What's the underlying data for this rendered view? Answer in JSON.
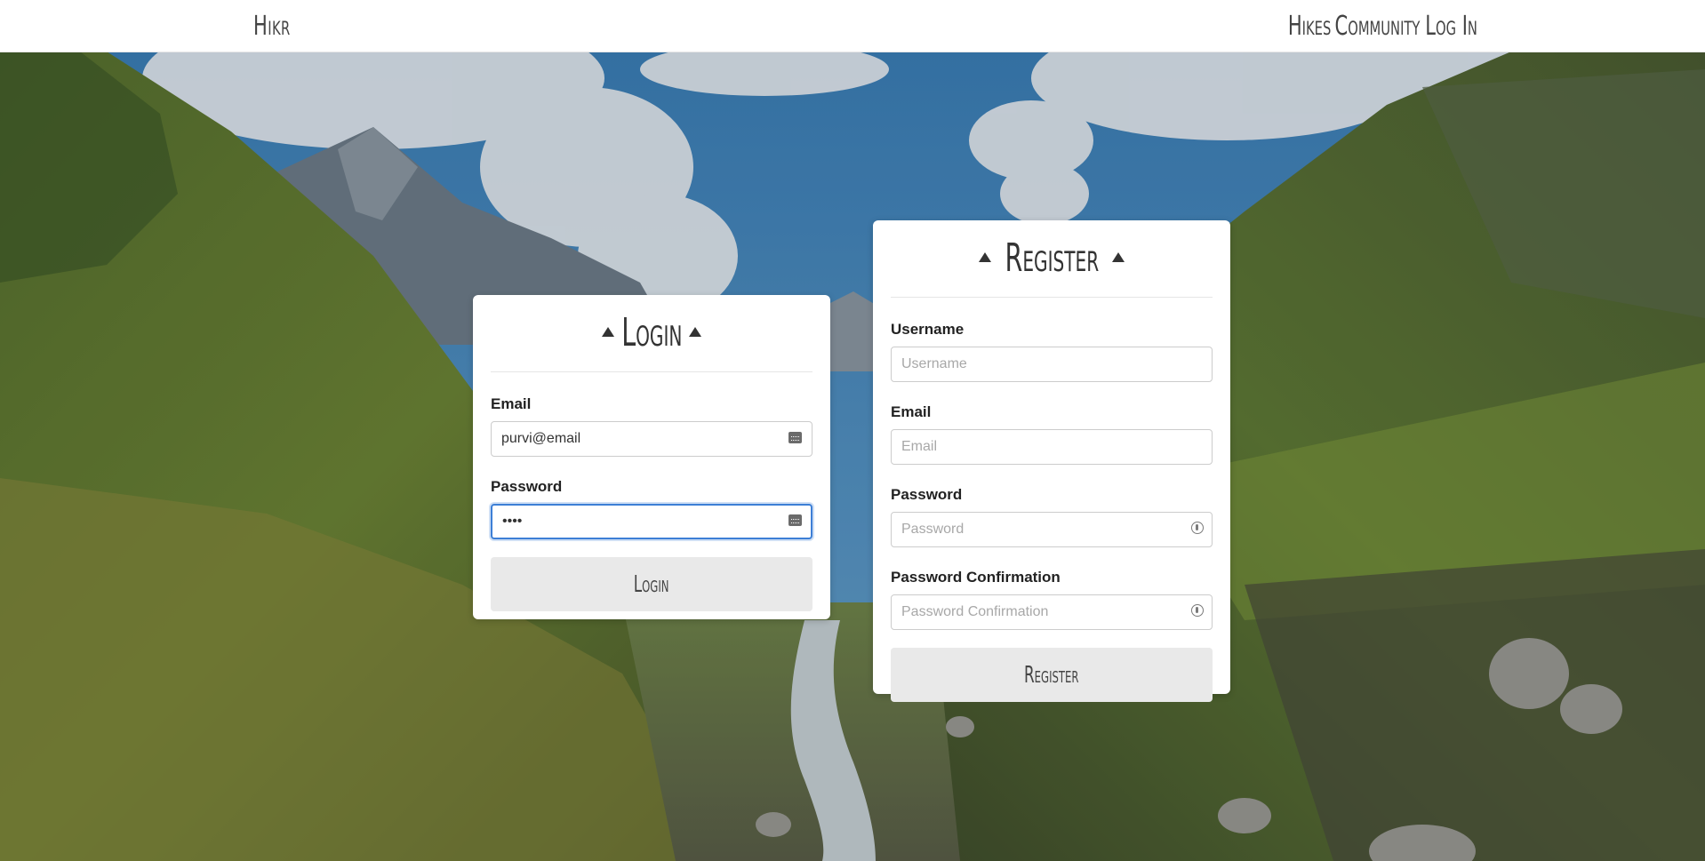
{
  "nav": {
    "brand": "Hikr",
    "links": [
      "Hikes",
      "Community",
      "Log In"
    ]
  },
  "login": {
    "title": "Login",
    "email_label": "Email",
    "email_value": "purvi@email",
    "password_label": "Password",
    "password_value": "••••",
    "submit_label": "Login"
  },
  "register": {
    "title": "Register",
    "username_label": "Username",
    "username_placeholder": "Username",
    "email_label": "Email",
    "email_placeholder": "Email",
    "password_label": "Password",
    "password_placeholder": "Password",
    "confirm_label": "Password Confirmation",
    "confirm_placeholder": "Password Confirmation",
    "submit_label": "Register"
  },
  "colors": {
    "focus_border": "#3d7fd6",
    "button_bg": "#e9e9e9",
    "nav_text": "#444444"
  }
}
